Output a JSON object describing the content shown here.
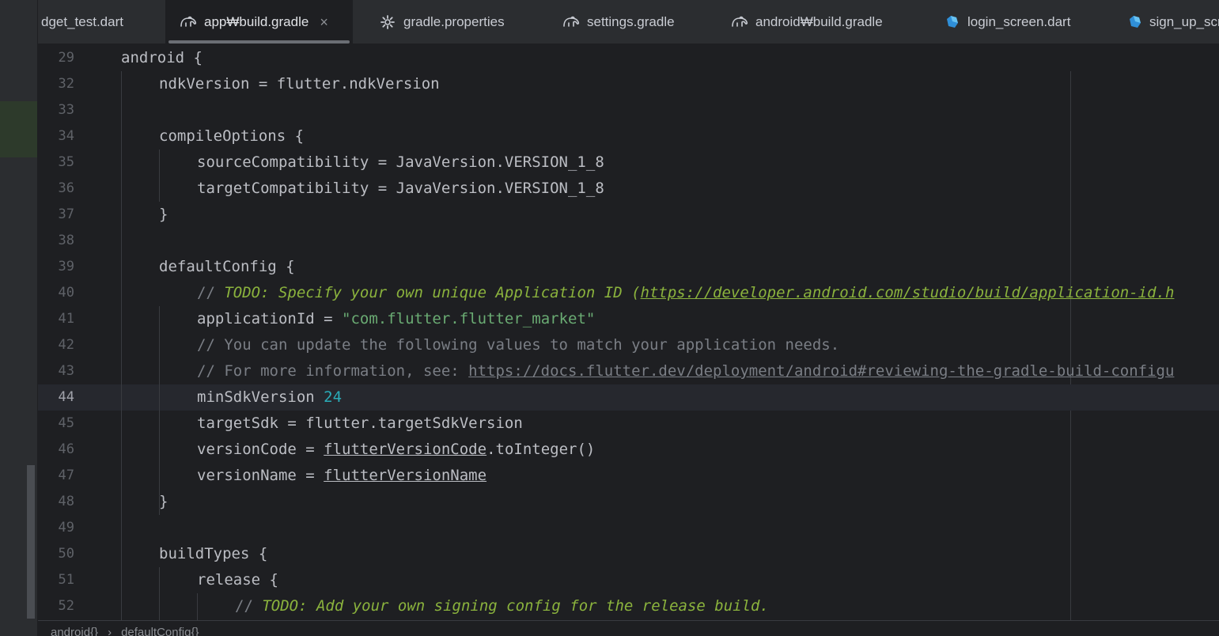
{
  "tabs": [
    {
      "label": "dget_test.dart",
      "icon": "none",
      "active": false
    },
    {
      "label": "app₩build.gradle",
      "icon": "gradle-elephant-icon",
      "active": true,
      "close": "×"
    },
    {
      "label": "gradle.properties",
      "icon": "gear-icon",
      "active": false
    },
    {
      "label": "settings.gradle",
      "icon": "gradle-elephant-icon",
      "active": false
    },
    {
      "label": "android₩build.gradle",
      "icon": "gradle-elephant-icon",
      "active": false
    },
    {
      "label": "login_screen.dart",
      "icon": "dart-icon",
      "active": false
    },
    {
      "label": "sign_up_scre",
      "icon": "dart-icon",
      "active": false
    }
  ],
  "lines": [
    {
      "n": "29",
      "t": "android {"
    },
    {
      "n": "32",
      "t": "ndkVersion = flutter.ndkVersion"
    },
    {
      "n": "33",
      "t": ""
    },
    {
      "n": "34",
      "t": "compileOptions {"
    },
    {
      "n": "35",
      "t": "sourceCompatibility = JavaVersion.VERSION_1_8"
    },
    {
      "n": "36",
      "t": "targetCompatibility = JavaVersion.VERSION_1_8"
    },
    {
      "n": "37",
      "t": "}"
    },
    {
      "n": "38",
      "t": ""
    },
    {
      "n": "39",
      "t": "defaultConfig {"
    },
    {
      "n": "40",
      "c": "// ",
      "todo": "TODO: Specify your own unique Application ID (",
      "url": "https://developer.android.com/studio/build/application-id.h"
    },
    {
      "n": "41",
      "t": "applicationId = ",
      "s": "\"com.flutter.flutter_market\""
    },
    {
      "n": "42",
      "c": "// You can update the following values to match your application needs."
    },
    {
      "n": "43",
      "c": "// For more information, see: ",
      "url": "https://docs.flutter.dev/deployment/android#reviewing-the-gradle-build-configu"
    },
    {
      "n": "44",
      "t": "minSdkVersion ",
      "num": "24"
    },
    {
      "n": "45",
      "t": "targetSdk = flutter.targetSdkVersion"
    },
    {
      "n": "46",
      "t": "versionCode = ",
      "u": "flutterVersionCode",
      "t2": ".toInteger()"
    },
    {
      "n": "47",
      "t": "versionName = ",
      "u": "flutterVersionName"
    },
    {
      "n": "48",
      "t": "}"
    },
    {
      "n": "49",
      "t": ""
    },
    {
      "n": "50",
      "t": "buildTypes {"
    },
    {
      "n": "51",
      "t": "release {"
    },
    {
      "n": "52",
      "c": "// ",
      "todo": "TODO: Add your own signing config for the release build."
    }
  ],
  "breadcrumb": [
    "android{}",
    "defaultConfig{}"
  ],
  "colors": {
    "accent": "#6b6e74",
    "comment": "#7a7e85",
    "todo": "#8bb33d",
    "string": "#6aab73",
    "number": "#2aacb8"
  }
}
